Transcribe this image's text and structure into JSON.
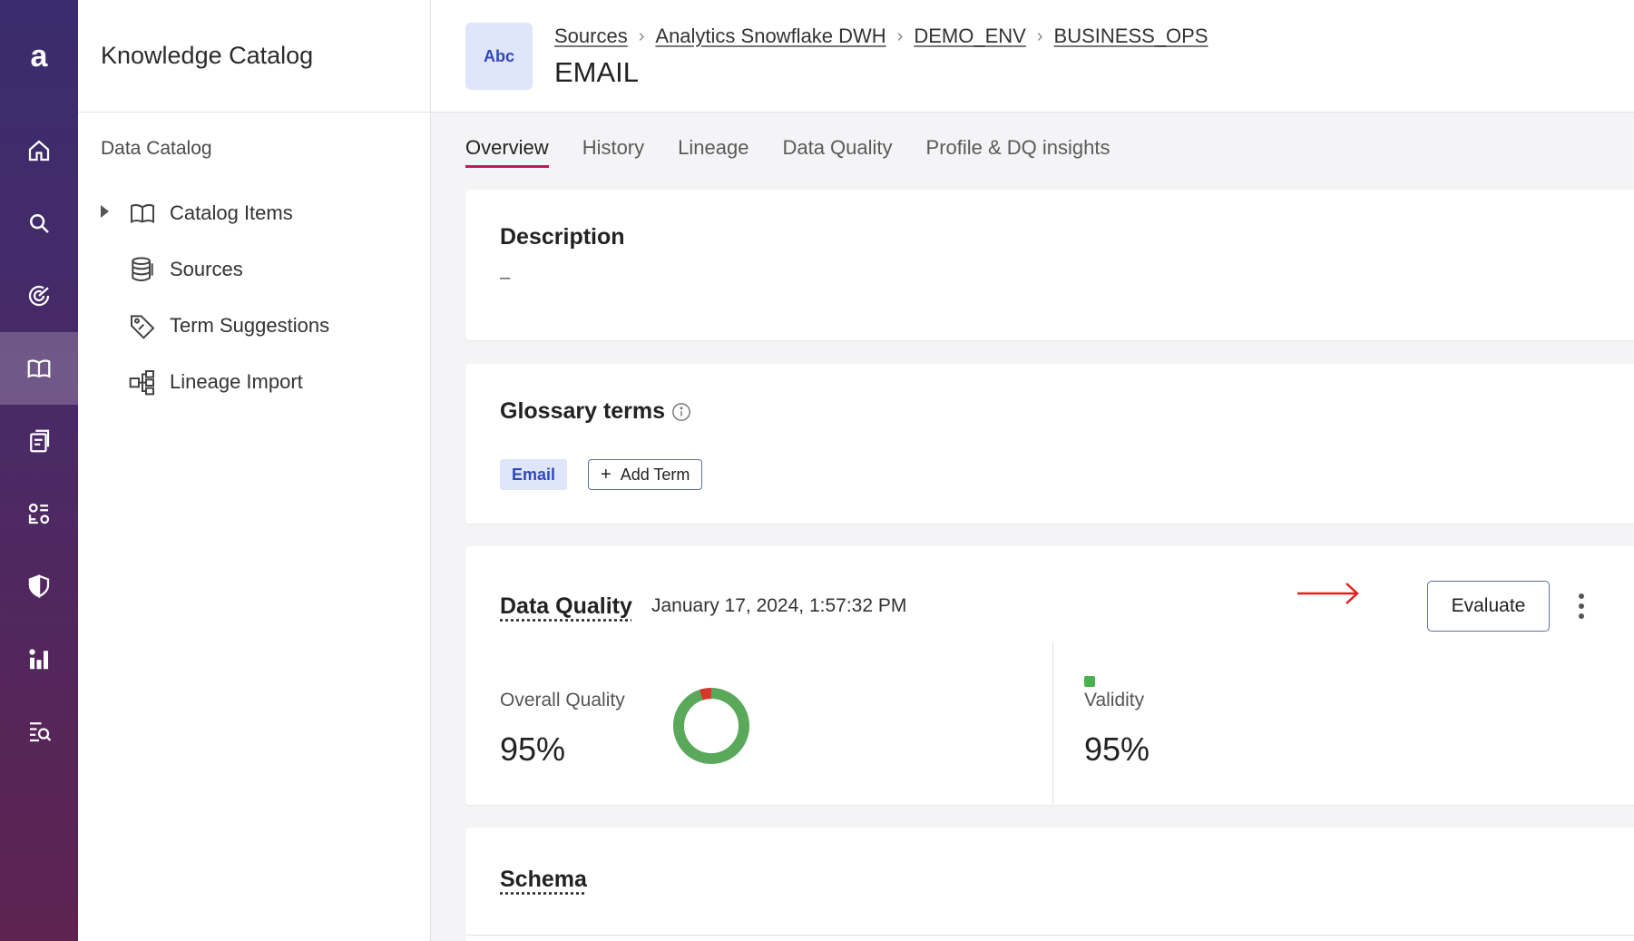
{
  "rail": {
    "logo": "a",
    "items": [
      "home-icon",
      "search-icon",
      "radar-icon",
      "book-icon",
      "documents-icon",
      "grid-shapes-icon",
      "shield-icon",
      "bar-chart-icon",
      "search-doc-icon"
    ],
    "active": "book-icon"
  },
  "nav": {
    "title": "Knowledge Catalog",
    "section": "Data Catalog",
    "items": [
      {
        "label": "Catalog Items",
        "icon": "book-icon"
      },
      {
        "label": "Sources",
        "icon": "database-icon"
      },
      {
        "label": "Term Suggestions",
        "icon": "tag-icon"
      },
      {
        "label": "Lineage Import",
        "icon": "hierarchy-icon"
      }
    ]
  },
  "header": {
    "badge": "Abc",
    "breadcrumbs": [
      "Sources",
      "Analytics Snowflake DWH",
      "DEMO_ENV",
      "BUSINESS_OPS"
    ],
    "title": "EMAIL"
  },
  "tabs": [
    "Overview",
    "History",
    "Lineage",
    "Data Quality",
    "Profile & DQ insights"
  ],
  "active_tab": "Overview",
  "description": {
    "title": "Description",
    "value": "–"
  },
  "glossary": {
    "title": "Glossary terms",
    "term": "Email",
    "add_label": "Add Term"
  },
  "data_quality": {
    "title": "Data Quality",
    "timestamp": "January 17, 2024, 1:57:32 PM",
    "evaluate_label": "Evaluate",
    "overall_label": "Overall Quality",
    "overall_value": "95%",
    "overall_fraction": 0.95,
    "validity_label": "Validity",
    "validity_value": "95%",
    "colors": {
      "good": "#5aa85a",
      "bad": "#d9352b",
      "annotation": "#e02020"
    }
  },
  "schema": {
    "title": "Schema"
  }
}
